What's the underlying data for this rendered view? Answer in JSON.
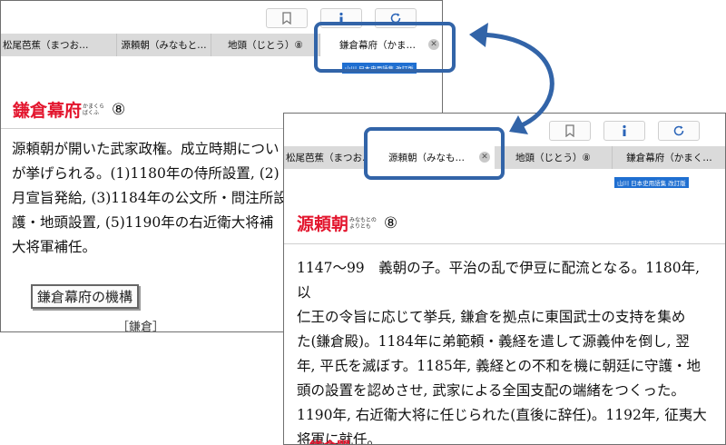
{
  "back": {
    "toolbar": {
      "bookmark_icon": "bookmark-icon",
      "info_icon": "info-icon",
      "refresh_icon": "refresh-icon"
    },
    "tabs": [
      {
        "label": "松尾芭蕉（まつお…"
      },
      {
        "label": "源頼朝（みなもと…"
      },
      {
        "label": "地頭（じとう）⑧"
      },
      {
        "label": "鎌倉幕府（かま…",
        "active": true
      }
    ],
    "badge": "山川 日本史用語集 改訂版",
    "entry": {
      "title": "鎌倉幕府",
      "ruby_top": "かまくら",
      "ruby_bottom": "ばくふ",
      "number": "⑧"
    },
    "body": "源頼朝が開いた武家政権。成立時期につい\nが挙げられる。(1)1180年の侍所設置, (2)\n月宣旨発給, (3)1184年の公文所・問注所設\n護・地頭設置, (5)1190年の右近衛大将補\n大将軍補任。",
    "link_label": "鎌倉幕府の機構",
    "ref_label": "［鎌倉］"
  },
  "front": {
    "toolbar": {
      "bookmark_icon": "bookmark-icon",
      "info_icon": "info-icon",
      "refresh_icon": "refresh-icon"
    },
    "tabs": [
      {
        "label": "松尾芭蕉（まつお…"
      },
      {
        "label": "源頼朝（みなも…",
        "active": true
      },
      {
        "label": "地頭（じとう）⑧"
      },
      {
        "label": "鎌倉幕府（かまく…"
      }
    ],
    "badge": "山川 日本史用語集 改訂版",
    "entry": {
      "title": "源頼朝",
      "ruby_top": "みなもとの",
      "ruby_bottom": "よりとも",
      "number": "⑧"
    },
    "body": "1147〜99　義朝の子。平治の乱で伊豆に配流となる。1180年, 以\n仁王の令旨に応じて挙兵, 鎌倉を拠点に東国武士の支持を集め\nた(鎌倉殿)。1184年に弟範頼・義経を遣して源義仲を倒し, 翌\n年, 平氏を滅ぼす。1185年, 義経との不和を機に朝廷に守護・地\n頭の設置を認めさせ, 武家による全国支配の端緒をつくった。\n1190年, 右近衛大将に任じられた(直後に辞任)。1192年, 征夷大\n将軍に就任。",
    "next_title": "鎌倉聞"
  },
  "colors": {
    "accent": "#3264a8",
    "title_red": "#e3162e",
    "badge_blue": "#1f6fd1"
  }
}
